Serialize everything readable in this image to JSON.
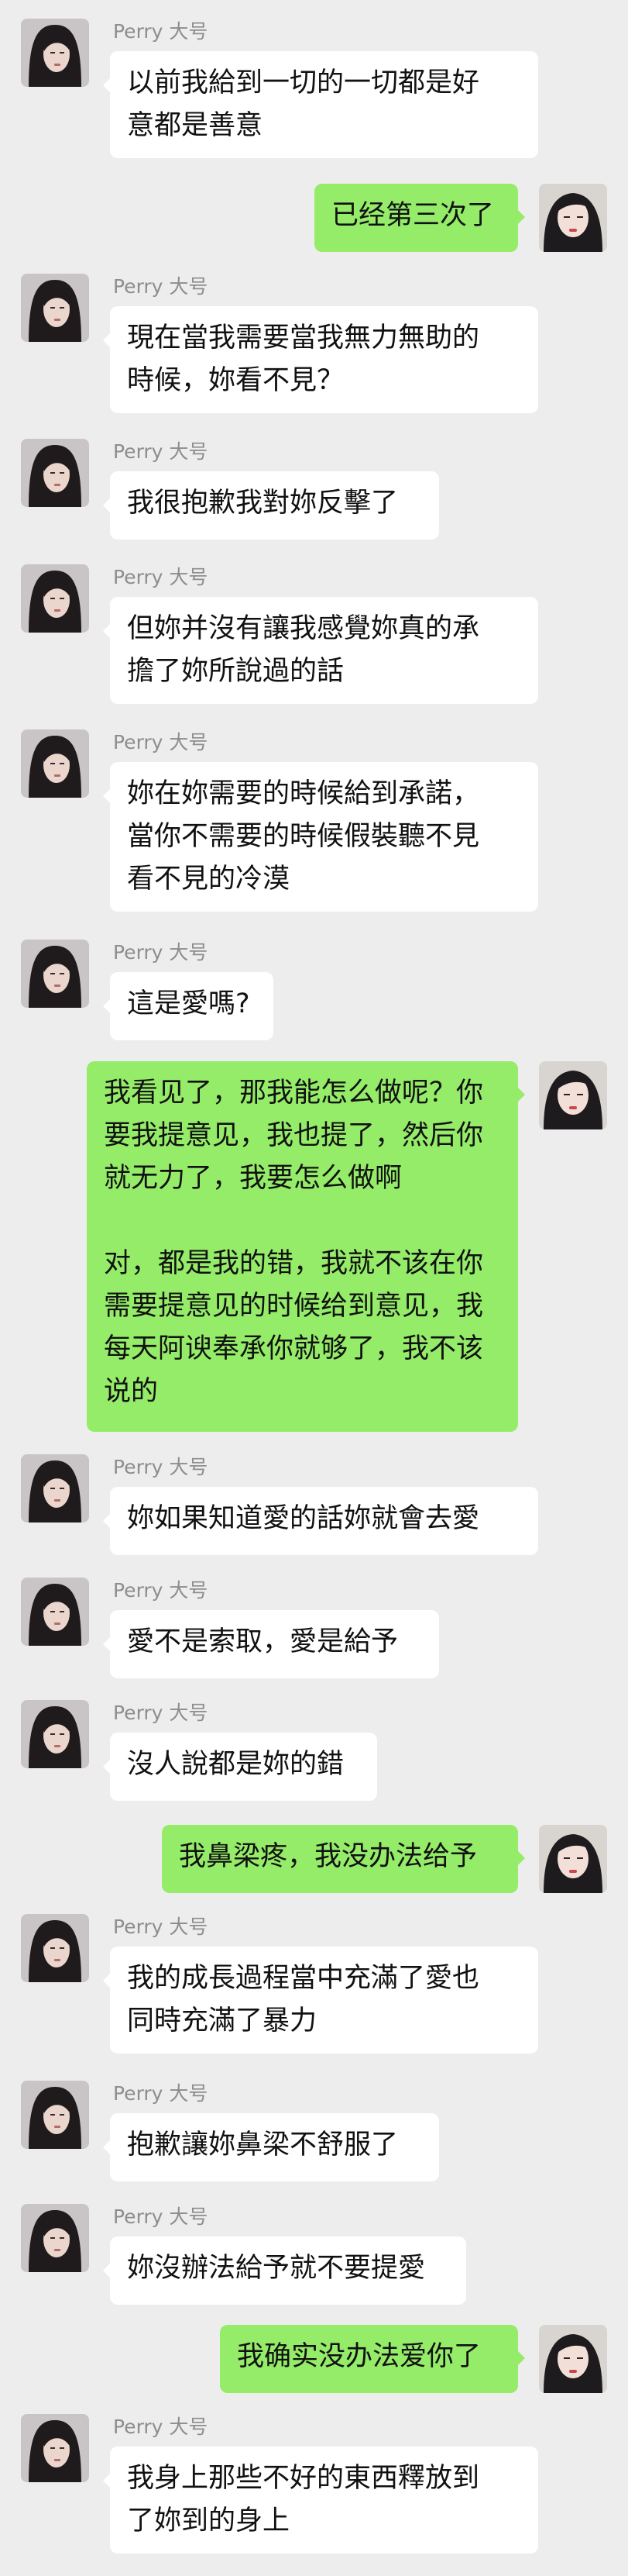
{
  "contact": {
    "nickname": "Perry 大号"
  },
  "messages": [
    {
      "from": "them",
      "text": "以前我給到一切的一切都是好\n意都是善意"
    },
    {
      "from": "me",
      "text": "已经第三次了"
    },
    {
      "from": "them",
      "text": "現在當我需要當我無力無助的\n時候，妳看不見？"
    },
    {
      "from": "them",
      "text": "我很抱歉我對妳反擊了"
    },
    {
      "from": "them",
      "text": "但妳并沒有讓我感覺妳真的承\n擔了妳所說過的話"
    },
    {
      "from": "them",
      "text": "妳在妳需要的時候給到承諾，\n當你不需要的時候假裝聽不見\n看不見的冷漠"
    },
    {
      "from": "them",
      "text": "這是愛嗎?"
    },
    {
      "from": "me",
      "text": "我看见了，那我能怎么做呢？你\n要我提意见，我也提了，然后你\n就无力了，我要怎么做啊\n\n对，都是我的错，我就不该在你\n需要提意见的时候给到意见，我\n每天阿谀奉承你就够了，我不该\n说的"
    },
    {
      "from": "them",
      "text": "妳如果知道愛的話妳就會去愛"
    },
    {
      "from": "them",
      "text": "愛不是索取，愛是給予"
    },
    {
      "from": "them",
      "text": "沒人說都是妳的錯"
    },
    {
      "from": "me",
      "text": "我鼻梁疼，我没办法给予"
    },
    {
      "from": "them",
      "text": "我的成長過程當中充滿了愛也\n同時充滿了暴力"
    },
    {
      "from": "them",
      "text": "抱歉讓妳鼻梁不舒服了"
    },
    {
      "from": "them",
      "text": "妳沒辦法給予就不要提愛"
    },
    {
      "from": "me",
      "text": "我确实没办法爱你了"
    },
    {
      "from": "them",
      "text": "我身上那些不好的東西釋放到\n了妳到的身上"
    }
  ]
}
